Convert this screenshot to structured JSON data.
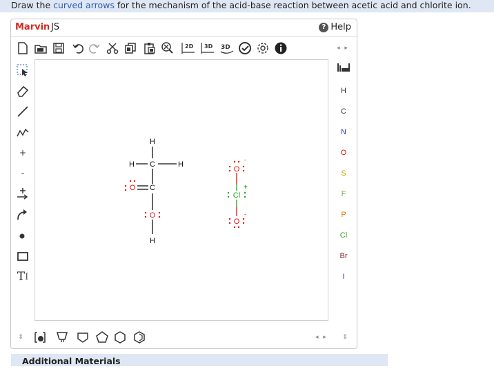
{
  "question": {
    "prefix": "Draw the ",
    "link": "curved arrows",
    "suffix": " for the mechanism of the acid-base reaction between acetic acid and chlorite ion."
  },
  "marvin": {
    "brand": "Marvin",
    "js": "JS",
    "help": "Help",
    "toolbar": {
      "2d_label": "2D",
      "3d_label": "3D",
      "3d_button": "3D"
    },
    "left_tools": {
      "plus_label": "+",
      "minus_label": "-",
      "text_tool": "T"
    },
    "elements": [
      "H",
      "C",
      "N",
      "O",
      "S",
      "F",
      "P",
      "Cl",
      "Br",
      "I"
    ],
    "element_colors": [
      "#333333",
      "#333333",
      "#2b34c9",
      "#e01010",
      "#c9a300",
      "#6bb33b",
      "#e07a00",
      "#22a022",
      "#8b2a2a",
      "#6a2aa0"
    ],
    "molecule": {
      "acetic_acid": {
        "h_top": "H",
        "h_left": "H",
        "c_methyl": "C",
        "h_right": "H",
        "o_carbonyl": "O",
        "c_carboxyl": "C",
        "o_hydroxyl": "O",
        "h_bottom": "H"
      },
      "chlorite": {
        "o_top": "O",
        "cl": "Cl",
        "plus": "+",
        "o_bottom": "O",
        "minus": "-"
      }
    }
  },
  "additional": "Additional Materials"
}
